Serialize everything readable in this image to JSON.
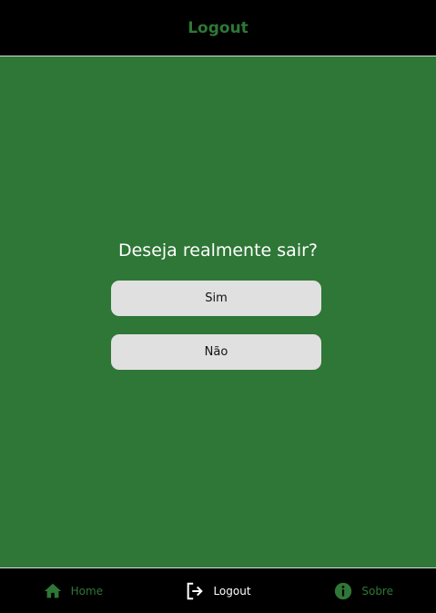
{
  "header": {
    "title": "Logout"
  },
  "dialog": {
    "question": "Deseja realmente sair?",
    "yes_label": "Sim",
    "no_label": "Não"
  },
  "bottom_nav": {
    "items": [
      {
        "label": "Home",
        "icon": "home-icon",
        "active": false
      },
      {
        "label": "Logout",
        "icon": "logout-icon",
        "active": true
      },
      {
        "label": "Sobre",
        "icon": "info-icon",
        "active": false
      }
    ]
  },
  "colors": {
    "accent_green": "#2e7736",
    "bar_background": "#000000",
    "button_background": "#e0e0e0",
    "active_nav": "#ffffff"
  }
}
